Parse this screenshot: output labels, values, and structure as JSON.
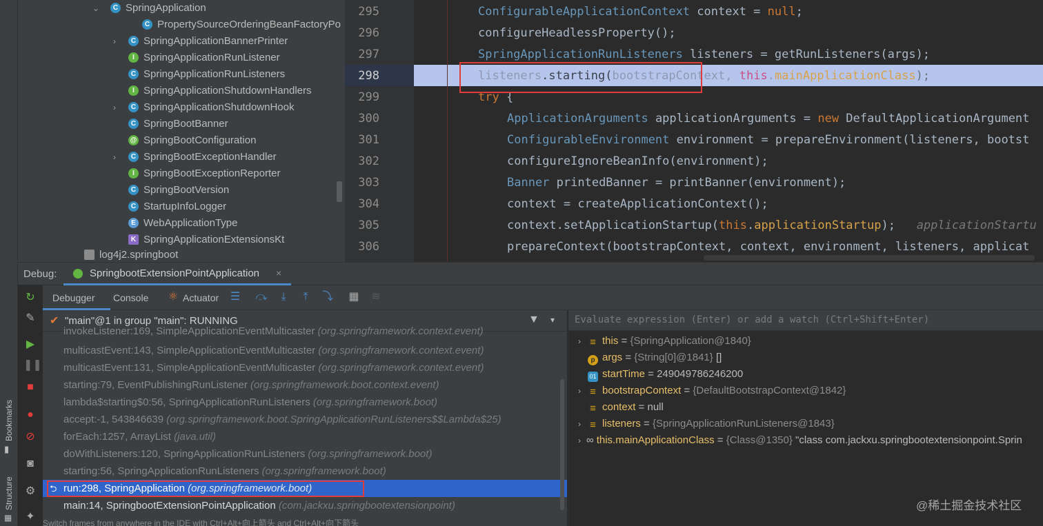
{
  "project_tree": {
    "items": [
      {
        "label": "SpringApplication",
        "icon": "class-icon",
        "expanded": true
      },
      {
        "label": "PropertySourceOrderingBeanFactoryPo",
        "icon": "class-icon"
      },
      {
        "label": "SpringApplicationBannerPrinter",
        "icon": "class-icon",
        "collapsed": true
      },
      {
        "label": "SpringApplicationRunListener",
        "icon": "interface-icon"
      },
      {
        "label": "SpringApplicationRunListeners",
        "icon": "class-icon"
      },
      {
        "label": "SpringApplicationShutdownHandlers",
        "icon": "interface-icon"
      },
      {
        "label": "SpringApplicationShutdownHook",
        "icon": "class-icon",
        "collapsed": true
      },
      {
        "label": "SpringBootBanner",
        "icon": "class-icon"
      },
      {
        "label": "SpringBootConfiguration",
        "icon": "annotation-icon"
      },
      {
        "label": "SpringBootExceptionHandler",
        "icon": "class-icon",
        "collapsed": true
      },
      {
        "label": "SpringBootExceptionReporter",
        "icon": "interface-icon"
      },
      {
        "label": "SpringBootVersion",
        "icon": "class-icon"
      },
      {
        "label": "StartupInfoLogger",
        "icon": "class-icon"
      },
      {
        "label": "WebApplicationType",
        "icon": "enum-icon"
      },
      {
        "label": "SpringApplicationExtensionsKt",
        "icon": "kotlin-file-icon"
      },
      {
        "label": "log4j2.springboot",
        "icon": "file-icon"
      }
    ]
  },
  "editor": {
    "line_numbers": [
      "295",
      "296",
      "297",
      "298",
      "299",
      "300",
      "301",
      "302",
      "303",
      "304",
      "305",
      "306"
    ],
    "lines": [
      {
        "a": "ConfigurableApplicationContext",
        "b": " context = ",
        "c": "null",
        "d": ";"
      },
      {
        "a": "configureHeadlessProperty();"
      },
      {
        "a": "SpringApplicationRunListeners",
        "b": " listeners = getRunListeners(args);"
      },
      {
        "a": "listeners",
        "b": ".starting(",
        "c": "bootstrapContext",
        "d": ", ",
        "e": "this",
        "f": ".",
        "g": "mainApplicationClass",
        "h": ");"
      },
      {
        "a": "try",
        "b": " {"
      },
      {
        "a": "ApplicationArguments",
        "b": " applicationArguments = ",
        "c": "new",
        "d": " DefaultApplicationArgument"
      },
      {
        "a": "ConfigurableEnvironment",
        "b": " environment = prepareEnvironment(listeners, bootst"
      },
      {
        "a": "configureIgnoreBeanInfo(environment);"
      },
      {
        "a": "Banner",
        "b": " printedBanner = printBanner(environment);"
      },
      {
        "a": "context = createApplicationContext();"
      },
      {
        "a": "context.setApplicationStartup(",
        "b": "this",
        "c": ".",
        "d": "applicationStartup",
        "e": ");",
        "f": "applicationStartu"
      },
      {
        "a": "prepareContext(bootstrapContext, context, environment, listeners, applicat"
      }
    ]
  },
  "debug": {
    "label": "Debug:",
    "session": "SpringbootExtensionPointApplication",
    "close": "×",
    "tabs": {
      "debugger": "Debugger",
      "console": "Console",
      "actuator": "Actuator"
    },
    "thread": "\"main\"@1 in group \"main\": RUNNING",
    "frames": [
      {
        "m": "invokeListener:169, SimpleApplicationEventMulticaster",
        "p": "(org.springframework.context.event)"
      },
      {
        "m": "multicastEvent:143, SimpleApplicationEventMulticaster",
        "p": "(org.springframework.context.event)"
      },
      {
        "m": "multicastEvent:131, SimpleApplicationEventMulticaster",
        "p": "(org.springframework.context.event)"
      },
      {
        "m": "starting:79, EventPublishingRunListener",
        "p": "(org.springframework.boot.context.event)"
      },
      {
        "m": "lambda$starting$0:56, SpringApplicationRunListeners",
        "p": "(org.springframework.boot)"
      },
      {
        "m": "accept:-1, 543846639",
        "p": "(org.springframework.boot.SpringApplicationRunListeners$$Lambda$25)"
      },
      {
        "m": "forEach:1257, ArrayList",
        "p": "(java.util)"
      },
      {
        "m": "doWithListeners:120, SpringApplicationRunListeners",
        "p": "(org.springframework.boot)"
      },
      {
        "m": "starting:56, SpringApplicationRunListeners",
        "p": "(org.springframework.boot)"
      },
      {
        "m": "run:298, SpringApplication",
        "p": "(org.springframework.boot)"
      },
      {
        "m": "main:14, SpringbootExtensionPointApplication",
        "p": "(com.jackxu.springbootextensionpoint)"
      }
    ],
    "status_hint": "Switch frames from anywhere in the IDE with Ctrl+Alt+向上箭头 and Ctrl+Alt+向下箭头",
    "evaluate_placeholder": "Evaluate expression (Enter) or add a watch (Ctrl+Shift+Enter)",
    "variables": [
      {
        "name": "this",
        "eq": " = ",
        "ref": "{SpringApplication@1840}",
        "val": ""
      },
      {
        "name": "args",
        "eq": " = ",
        "ref": "{String[0]@1841}",
        "val": " []"
      },
      {
        "name": "startTime",
        "eq": " = ",
        "ref": "",
        "val": "249049786246200"
      },
      {
        "name": "bootstrapContext",
        "eq": " = ",
        "ref": "{DefaultBootstrapContext@1842}",
        "val": ""
      },
      {
        "name": "context",
        "eq": " = ",
        "ref": "",
        "val": "null"
      },
      {
        "name": "listeners",
        "eq": " = ",
        "ref": "{SpringApplicationRunListeners@1843}",
        "val": ""
      },
      {
        "name": "this.mainApplicationClass",
        "eq": " = ",
        "ref": "{Class@1350}",
        "val": " \"class com.jackxu.springbootextensionpoint.Sprin"
      }
    ]
  },
  "side_labels": {
    "bookmarks": "Bookmarks",
    "structure": "Structure"
  },
  "watermark": "@稀土掘金技术社区",
  "colors": {
    "selection": "#2f65ca",
    "highlight_line": "#b5c5ec",
    "keyword": "#cc7832",
    "type": "#6897bb",
    "field": "#9876aa",
    "annotation_box": "#e03c3c"
  }
}
